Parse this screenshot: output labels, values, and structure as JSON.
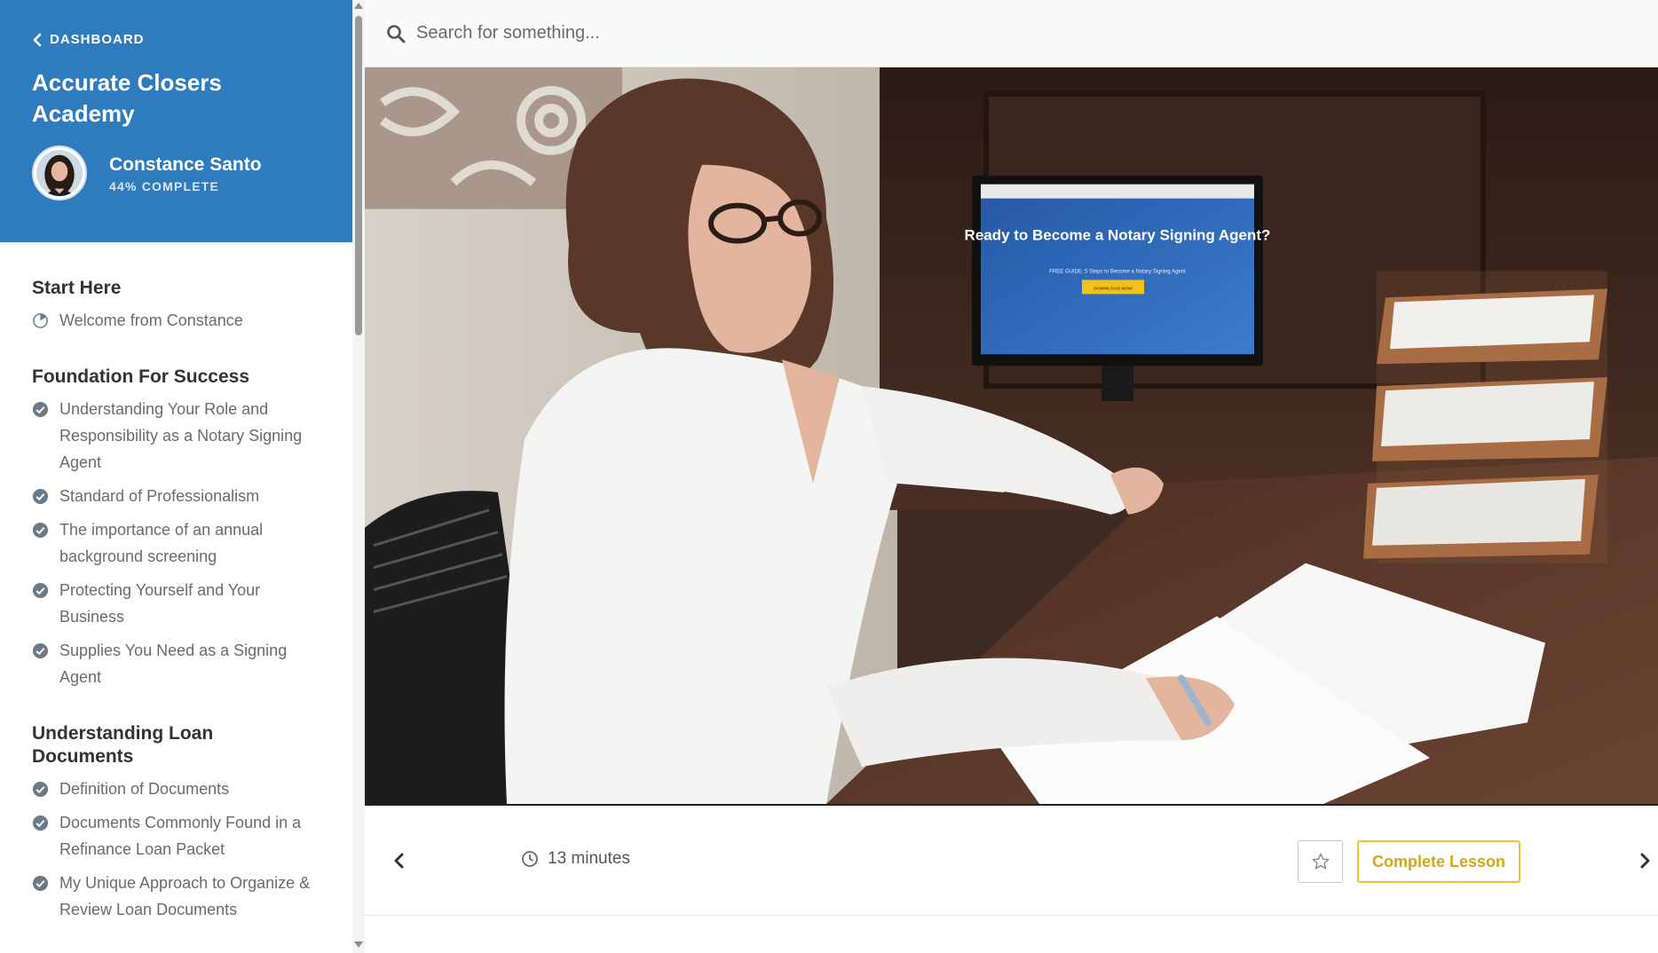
{
  "sidebar": {
    "back_label": "DASHBOARD",
    "course_title": "Accurate Closers Academy",
    "user": {
      "name": "Constance Santo",
      "progress": "44% COMPLETE"
    },
    "sections": [
      {
        "title": "Start Here",
        "lessons": [
          {
            "label": "Welcome from Constance",
            "status": "in-progress"
          }
        ]
      },
      {
        "title": "Foundation For Success",
        "lessons": [
          {
            "label": "Understanding Your Role and Responsibility as a Notary Signing Agent",
            "status": "complete"
          },
          {
            "label": "Standard of Professionalism",
            "status": "complete"
          },
          {
            "label": "The importance of an annual background screening",
            "status": "complete"
          },
          {
            "label": "Protecting Yourself and Your Business",
            "status": "complete"
          },
          {
            "label": "Supplies You Need as a Signing Agent",
            "status": "complete"
          }
        ]
      },
      {
        "title": "Understanding Loan Documents",
        "lessons": [
          {
            "label": "Definition of Documents",
            "status": "complete"
          },
          {
            "label": "Documents Commonly Found in a Refinance Loan Packet",
            "status": "complete"
          },
          {
            "label": "My Unique Approach to Organize & Review Loan Documents",
            "status": "complete"
          }
        ]
      }
    ]
  },
  "search": {
    "placeholder": "Search for something..."
  },
  "video": {
    "monitor_title": "Ready to Become a Notary Signing Agent?",
    "monitor_subtitle": "FREE GUIDE: 5 Steps to Become a Notary Signing Agent",
    "monitor_button": "DOWNLOAD NOW"
  },
  "lesson_bar": {
    "duration": "13 minutes",
    "complete_label": "Complete Lesson"
  },
  "colors": {
    "brand": "#2e7bbd",
    "accent": "#e8c23a",
    "complete_icon": "#6b7a87"
  }
}
